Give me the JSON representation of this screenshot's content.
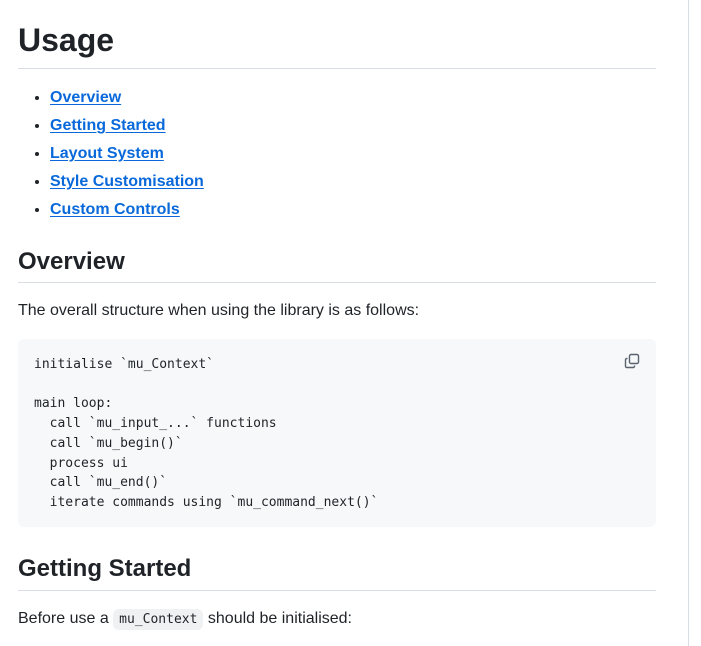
{
  "usage": {
    "title": "Usage"
  },
  "toc": {
    "items": [
      {
        "label": "Overview"
      },
      {
        "label": "Getting Started"
      },
      {
        "label": "Layout System"
      },
      {
        "label": "Style Customisation"
      },
      {
        "label": "Custom Controls"
      }
    ]
  },
  "overview": {
    "title": "Overview",
    "intro": "The overall structure when using the library is as follows:",
    "code": "initialise `mu_Context`\n\nmain loop:\n  call `mu_input_...` functions\n  call `mu_begin()`\n  process ui\n  call `mu_end()`\n  iterate commands using `mu_command_next()`",
    "copy_icon": "copy-icon"
  },
  "getting_started": {
    "title": "Getting Started",
    "text_before": "Before use a ",
    "inline_code": "mu_Context",
    "text_after": " should be initialised:"
  },
  "colors": {
    "link": "#0969da",
    "text": "#1f2328",
    "code_bg": "#f6f8fa",
    "rule": "#d8dee4"
  }
}
